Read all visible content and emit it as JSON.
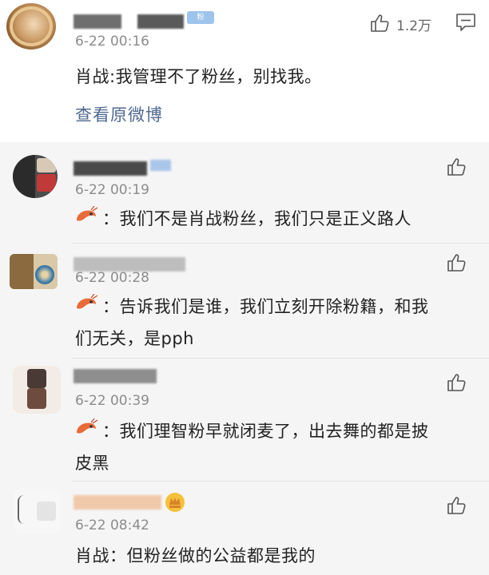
{
  "post": {
    "time": "6-22 00:16",
    "text": "肖战:我管理不了粉丝，别找我。",
    "link": "查看原微博",
    "likes": "1.2万",
    "vip_label": "粉"
  },
  "replies": [
    {
      "time": "6-22 00:19",
      "text": "：我们不是肖战粉丝，我们只是正义路人"
    },
    {
      "time": "6-22 00:28",
      "text_line1": "：告诉我们是谁，我们立刻开除粉籍，和我",
      "text_line2": "们无关，是pph"
    },
    {
      "time": "6-22 00:39",
      "text_line1": "：我们理智粉早就闭麦了，出去舞的都是披",
      "text_line2": "皮黑"
    },
    {
      "time": "6-22 08:42",
      "text": "肖战：但粉丝做的公益都是我的"
    }
  ],
  "colors": {
    "link": "#50698f",
    "time": "#8c8c8c",
    "reply_bg": "#f5f5f5"
  },
  "icons": [
    "thumbs-up-icon",
    "comment-icon",
    "shrimp-emoji-icon",
    "crown-emoji-icon"
  ]
}
